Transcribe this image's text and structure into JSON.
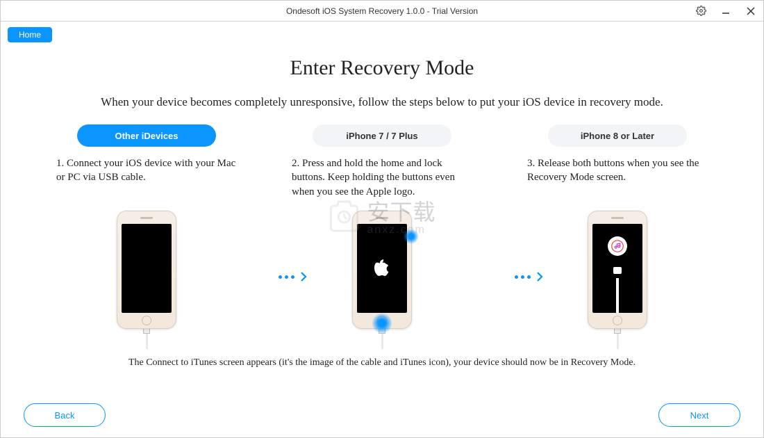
{
  "titlebar": {
    "title": "Ondesoft iOS System Recovery 1.0.0 - Trial Version"
  },
  "home_label": "Home",
  "page_title": "Enter Recovery Mode",
  "subtitle": "When your device becomes completely unresponsive, follow the steps below to put your iOS device in recovery mode.",
  "tabs": {
    "other": "Other iDevices",
    "iphone7": "iPhone 7 / 7 Plus",
    "iphone8": "iPhone 8 or Later"
  },
  "steps": {
    "s1": "1. Connect your iOS device with your Mac or PC via USB cable.",
    "s2": "2. Press and hold the home and lock buttons. Keep holding the buttons even when you see the Apple logo.",
    "s3": "3. Release both buttons when you see the Recovery Mode screen."
  },
  "footer_note": "The Connect to iTunes screen appears (it's the image of the cable and iTunes icon), your device should now be in Recovery Mode.",
  "nav": {
    "back": "Back",
    "next": "Next"
  },
  "watermark": {
    "main": "安下载",
    "sub": "anxz.com"
  },
  "colors": {
    "accent": "#0a95ff"
  }
}
